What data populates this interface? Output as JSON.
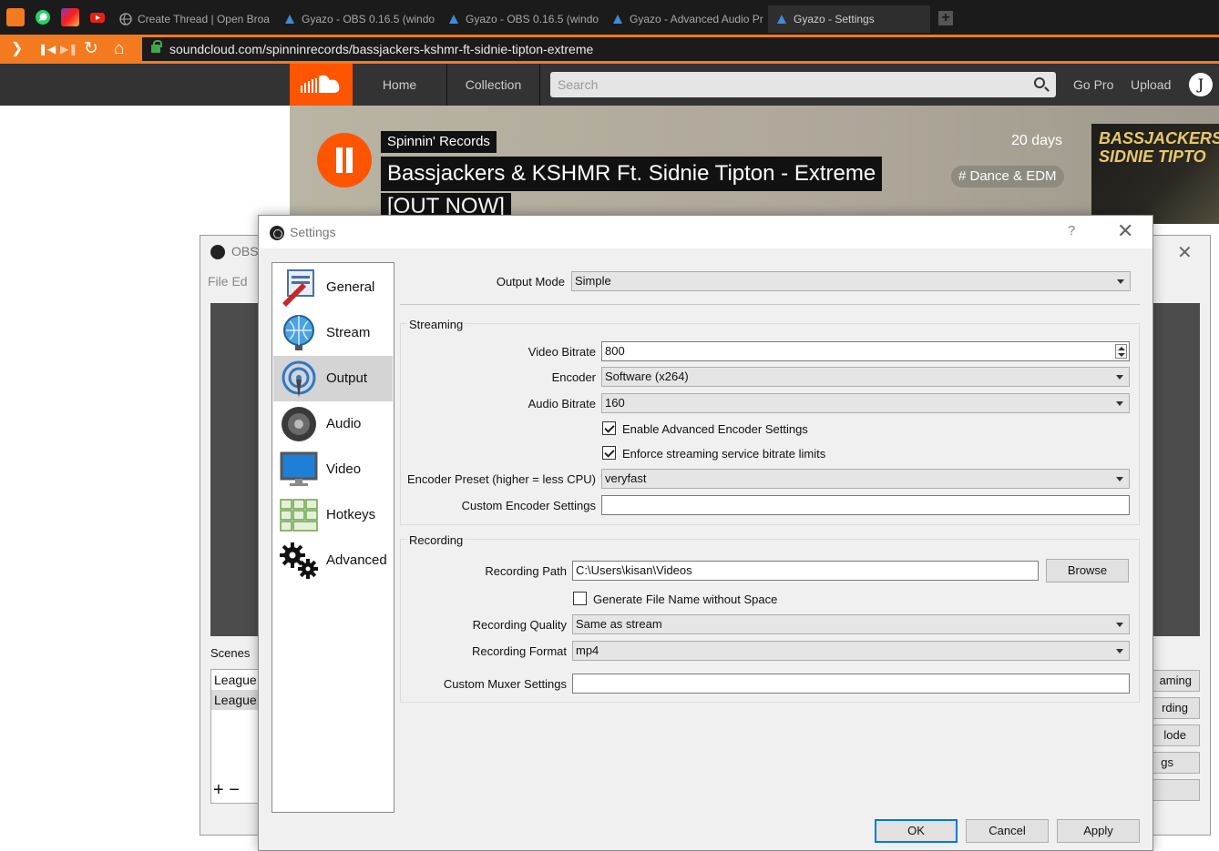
{
  "browser": {
    "tabs": [
      {
        "label": "Create Thread | Open Broa",
        "icon": "globe-icon"
      },
      {
        "label": "Gyazo - OBS 0.16.5 (windo",
        "icon": "gyazo-icon"
      },
      {
        "label": "Gyazo - OBS 0.16.5 (windo",
        "icon": "gyazo-icon"
      },
      {
        "label": "Gyazo - Advanced Audio Pr",
        "icon": "gyazo-icon"
      },
      {
        "label": "Gyazo - Settings",
        "icon": "gyazo-icon"
      }
    ],
    "new_tab": "+",
    "url": "soundcloud.com/spinninrecords/bassjackers-kshmr-ft-sidnie-tipton-extreme",
    "accent": "#f47a20"
  },
  "soundcloud": {
    "nav": {
      "home": "Home",
      "collection": "Collection",
      "go_pro": "Go Pro",
      "upload": "Upload"
    },
    "search_placeholder": "Search",
    "avatar_letter": "J",
    "track": {
      "artist": "Spinnin' Records",
      "title_line1": "Bassjackers & KSHMR Ft. Sidnie Tipton - Extreme",
      "title_line2": "[OUT NOW]",
      "age": "20 days",
      "tag": "# Dance & EDM",
      "art_text": "BASSJACKERS ft. SIDNIE TIPTO"
    },
    "brand": "#ff5500"
  },
  "obs": {
    "title": "OBS",
    "menu": "File  Ed",
    "scenes_label": "Scenes",
    "scenes": [
      "League",
      "League"
    ],
    "scene_controls": "+ −",
    "controls": [
      "aming",
      "rding",
      "lode",
      "gs",
      ""
    ]
  },
  "settings": {
    "title": "Settings",
    "help": "?",
    "close": "✕",
    "categories": [
      {
        "label": "General",
        "icon": "general-icon"
      },
      {
        "label": "Stream",
        "icon": "stream-icon"
      },
      {
        "label": "Output",
        "icon": "output-icon",
        "selected": true
      },
      {
        "label": "Audio",
        "icon": "audio-icon"
      },
      {
        "label": "Video",
        "icon": "video-icon"
      },
      {
        "label": "Hotkeys",
        "icon": "hotkeys-icon"
      },
      {
        "label": "Advanced",
        "icon": "advanced-icon"
      }
    ],
    "output_mode_label": "Output Mode",
    "output_mode": "Simple",
    "streaming": {
      "group_title": "Streaming",
      "video_bitrate_label": "Video Bitrate",
      "video_bitrate": "800",
      "encoder_label": "Encoder",
      "encoder": "Software (x264)",
      "audio_bitrate_label": "Audio Bitrate",
      "audio_bitrate": "160",
      "adv_encoder_label": "Enable Advanced Encoder Settings",
      "adv_encoder_checked": true,
      "enforce_label": "Enforce streaming service bitrate limits",
      "enforce_checked": true,
      "preset_label": "Encoder Preset (higher = less CPU)",
      "preset": "veryfast",
      "custom_label": "Custom Encoder Settings",
      "custom_value": ""
    },
    "recording": {
      "group_title": "Recording",
      "path_label": "Recording Path",
      "path": "C:\\Users\\kisan\\Videos",
      "browse": "Browse",
      "nospace_label": "Generate File Name without Space",
      "nospace_checked": false,
      "quality_label": "Recording Quality",
      "quality": "Same as stream",
      "format_label": "Recording Format",
      "format": "mp4",
      "muxer_label": "Custom Muxer Settings",
      "muxer_value": ""
    },
    "buttons": {
      "ok": "OK",
      "cancel": "Cancel",
      "apply": "Apply"
    },
    "default_button_color": "#0078d7"
  }
}
